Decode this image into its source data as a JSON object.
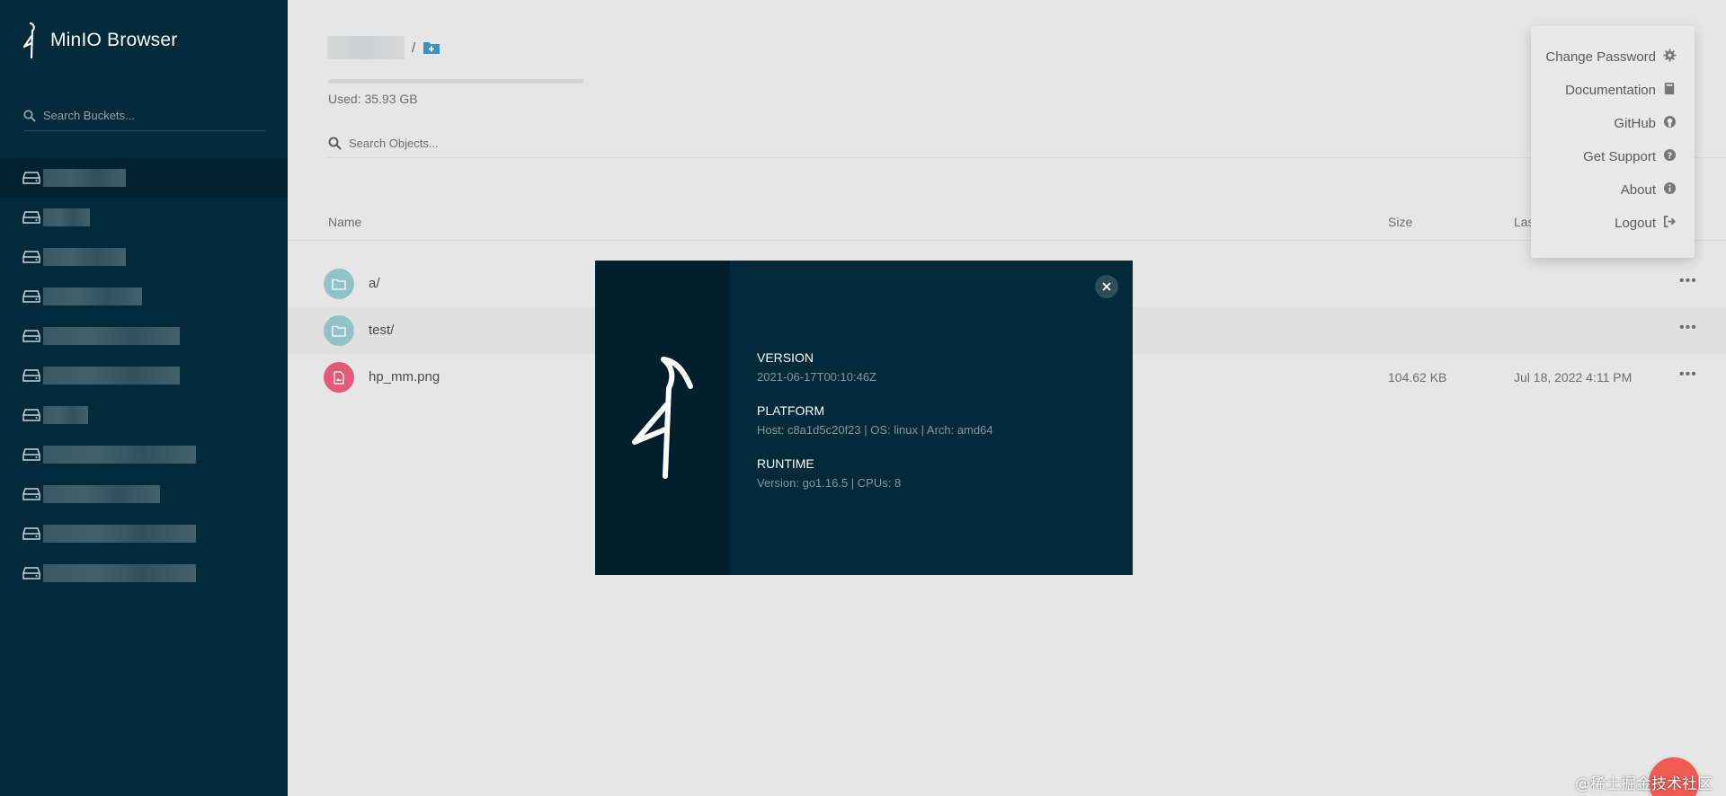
{
  "app": {
    "title": "MinIO Browser"
  },
  "sidebar": {
    "search_placeholder": "Search Buckets...",
    "buckets": [
      {
        "active": true
      },
      {
        "active": false
      },
      {
        "active": false
      },
      {
        "active": false
      },
      {
        "active": false
      },
      {
        "active": false
      },
      {
        "active": false
      },
      {
        "active": false
      },
      {
        "active": false
      },
      {
        "active": false
      },
      {
        "active": false
      }
    ]
  },
  "main": {
    "breadcrumb_separator": "/",
    "used_text": "Used: 35.93 GB",
    "search_placeholder": "Search Objects...",
    "columns": {
      "name": "Name",
      "size": "Size",
      "last_modified": "Las"
    },
    "rows": [
      {
        "name": "a/",
        "type": "folder",
        "size": "",
        "date": ""
      },
      {
        "name": "test/",
        "type": "folder",
        "size": "",
        "date": ""
      },
      {
        "name": "hp_mm.png",
        "type": "image",
        "size": "104.62 KB",
        "date": "Jul 18, 2022 4:11 PM"
      }
    ]
  },
  "menu": {
    "items": [
      {
        "label": "Change Password",
        "icon": "gear-icon"
      },
      {
        "label": "Documentation",
        "icon": "book-icon"
      },
      {
        "label": "GitHub",
        "icon": "github-icon"
      },
      {
        "label": "Get Support",
        "icon": "question-icon"
      },
      {
        "label": "About",
        "icon": "info-icon"
      },
      {
        "label": "Logout",
        "icon": "logout-icon"
      }
    ]
  },
  "about_modal": {
    "version_label": "VERSION",
    "version_value": "2021-06-17T00:10:46Z",
    "platform_label": "PLATFORM",
    "platform_value": "Host: c8a1d5c20f23 | OS: linux | Arch: amd64",
    "runtime_label": "RUNTIME",
    "runtime_value": "Version: go1.16.5 | CPUs: 8"
  },
  "watermark": "@稀土掘金技术社区",
  "colors": {
    "sidebar": "#022a3a",
    "folder_icon": "#8fc3c8",
    "image_icon": "#e15a7a",
    "fab": "#f05a54"
  }
}
